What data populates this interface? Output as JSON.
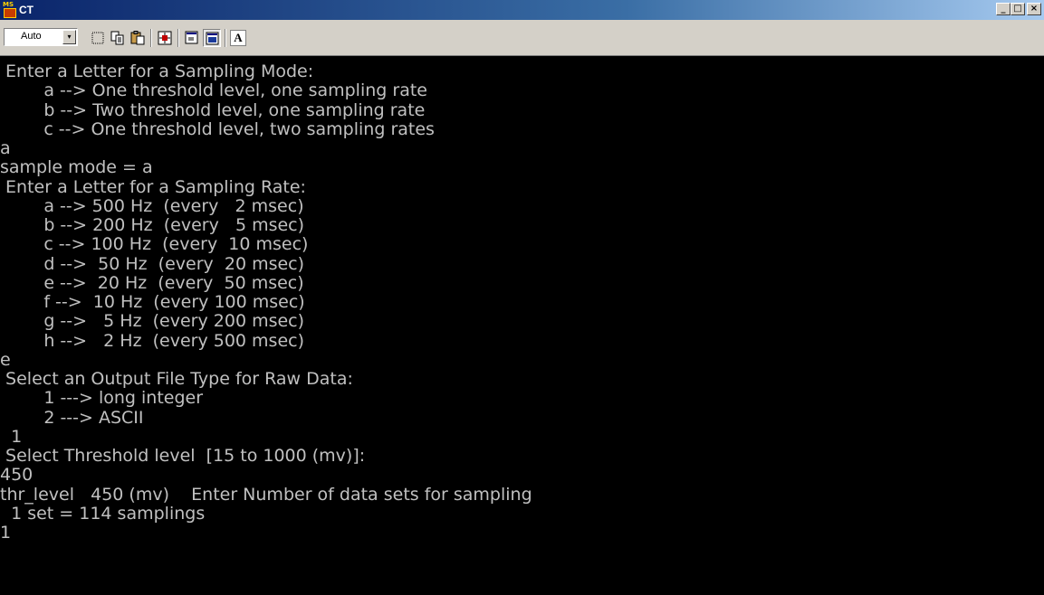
{
  "window": {
    "title": "CT",
    "icon_text": "MS",
    "minimize_label": "_",
    "maximize_label": "□",
    "close_label": "×"
  },
  "toolbar": {
    "font_size_value": "Auto",
    "dropdown_glyph": "▾",
    "buttons": [
      "mark-icon",
      "copy-icon",
      "paste-icon",
      "fullscreen-icon",
      "properties-icon",
      "background-icon"
    ],
    "font_button_label": "A"
  },
  "console": {
    "lines": [
      " Enter a Letter for a Sampling Mode:",
      "        a --> One threshold level, one sampling rate",
      "        b --> Two threshold level, one sampling rate",
      "        c --> One threshold level, two sampling rates",
      "a",
      "sample mode = a",
      " Enter a Letter for a Sampling Rate:",
      "        a --> 500 Hz  (every   2 msec)",
      "        b --> 200 Hz  (every   5 msec)",
      "        c --> 100 Hz  (every  10 msec)",
      "        d -->  50 Hz  (every  20 msec)",
      "        e -->  20 Hz  (every  50 msec)",
      "        f -->  10 Hz  (every 100 msec)",
      "        g -->   5 Hz  (every 200 msec)",
      "        h -->   2 Hz  (every 500 msec)",
      "e",
      " Select an Output File Type for Raw Data:",
      "        1 ---> long integer",
      "        2 ---> ASCII",
      "  1",
      " Select Threshold level  [15 to 1000 (mv)]:",
      "450",
      "thr_level   450 (mv)    Enter Number of data sets for sampling",
      "  1 set = 114 samplings",
      "1"
    ]
  },
  "colors": {
    "console_bg": "#000000",
    "console_text": "#c0c0c0",
    "titlebar_start": "#0a246a",
    "titlebar_end": "#a6caf0"
  }
}
